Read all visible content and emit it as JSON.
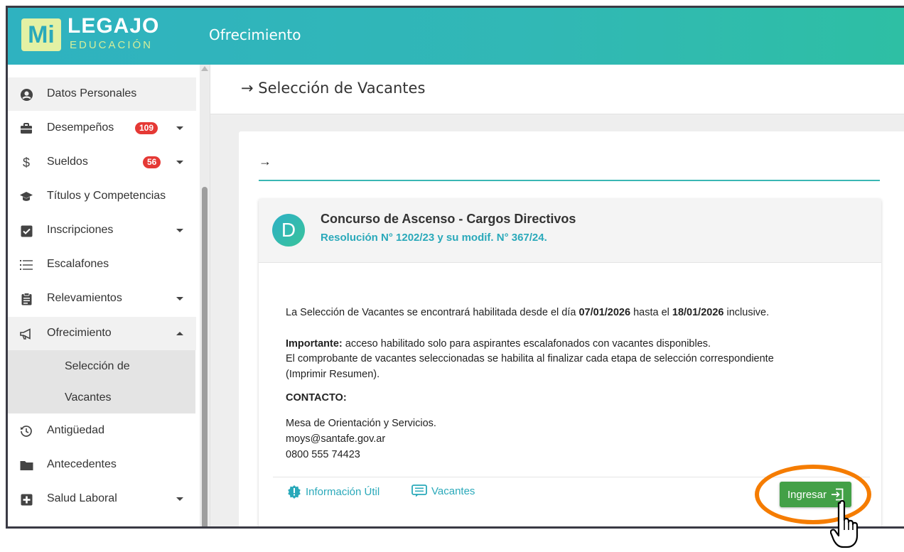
{
  "app": {
    "logo_mark": "Mi",
    "logo_title": "LEGAJO",
    "logo_subtitle": "EDUCACIÓN",
    "section_title": "Ofrecimiento"
  },
  "sidebar": {
    "items": [
      {
        "label": "Datos Personales",
        "icon": "user-circle-icon"
      },
      {
        "label": "Desempeños",
        "icon": "briefcase-icon",
        "badge": "109"
      },
      {
        "label": "Sueldos",
        "icon": "dollar-icon",
        "badge": "56"
      },
      {
        "label": "Títulos y Competencias",
        "icon": "graduation-cap-icon"
      },
      {
        "label": "Inscripciones",
        "icon": "checkbox-icon"
      },
      {
        "label": "Escalafones",
        "icon": "list-icon"
      },
      {
        "label": "Relevamientos",
        "icon": "clipboard-icon"
      },
      {
        "label": "Ofrecimiento",
        "icon": "megaphone-icon"
      },
      {
        "label": "Selección de",
        "sub": true
      },
      {
        "label": "Vacantes",
        "sub": true
      },
      {
        "label": "Antigüedad",
        "icon": "history-icon"
      },
      {
        "label": "Antecedentes",
        "icon": "folder-icon"
      },
      {
        "label": "Salud Laboral",
        "icon": "medical-plus-icon"
      }
    ]
  },
  "main": {
    "breadcrumb": "Selección de Vacantes",
    "card": {
      "avatar_letter": "D",
      "title": "Concurso de Ascenso - Cargos Directivos",
      "subtitle": "Resolución N° 1202/23 y su modif. N° 367/24.",
      "line1_pre": "La Selección de Vacantes se encontrará habilitada desde el día ",
      "date_from": "07/01/2026",
      "line1_mid": " hasta el ",
      "date_to": "18/01/2026",
      "line1_post": " inclusive.",
      "important_label": "Importante:",
      "important_text": " acceso habilitado solo para aspirantes escalafonados con vacantes disponibles.",
      "note_line1": "El comprobante de vacantes seleccionadas se habilita al finalizar cada etapa de selección correspondiente",
      "note_line2": "(Imprimir Resumen).",
      "contact_label": "CONTACTO:",
      "contact_org": "Mesa de Orientación y Servicios.",
      "contact_email": "moys@santafe.gov.ar",
      "contact_phone": "0800 555 74423",
      "link_info": "Información Útil",
      "link_vacantes": "Vacantes",
      "button_label": "Ingresar"
    }
  },
  "colors": {
    "brand_teal": "#2fb2c0",
    "accent_green": "#43a047",
    "badge_red": "#e53935",
    "highlight_orange": "#f57c00"
  }
}
